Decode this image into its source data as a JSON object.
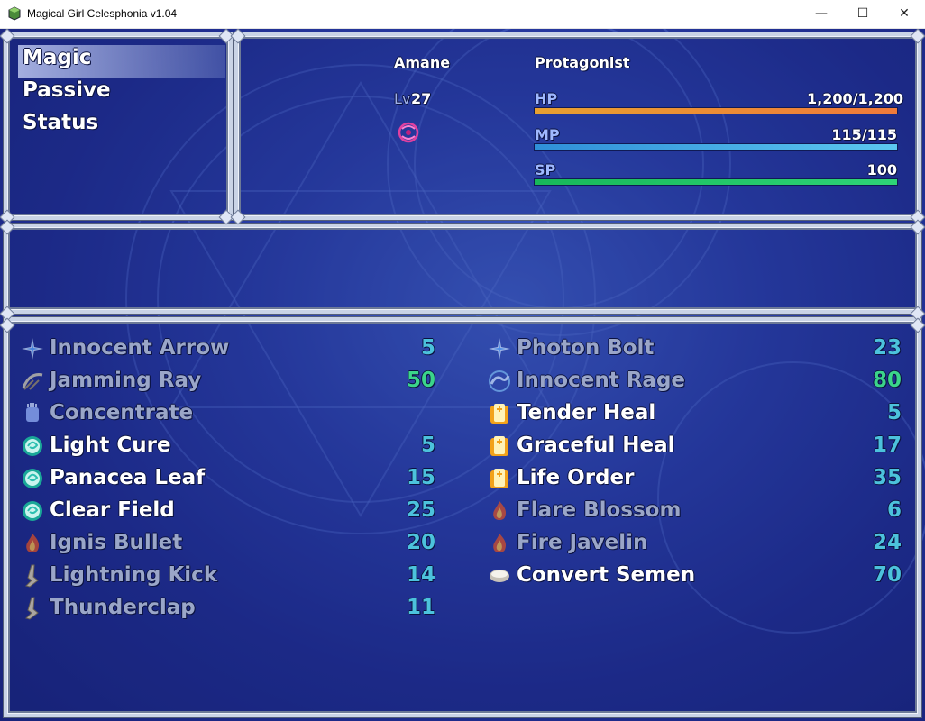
{
  "window": {
    "title": "Magical Girl Celesphonia v1.04",
    "min_glyph": "—",
    "max_glyph": "☐",
    "close_glyph": "✕"
  },
  "commands": [
    {
      "label": "Magic",
      "selected": true
    },
    {
      "label": "Passive",
      "selected": false
    },
    {
      "label": "Status",
      "selected": false
    }
  ],
  "actor": {
    "name": "Amane",
    "class": "Protagonist",
    "level_label": "Lv",
    "level": "27",
    "state_icon": "spiral-state-icon",
    "hp": {
      "label": "HP",
      "value": "1,200/1,200",
      "ratio": 1.0
    },
    "mp": {
      "label": "MP",
      "value": "115/115",
      "ratio": 1.0
    },
    "sp": {
      "label": "SP",
      "value": "100",
      "ratio": 1.0
    }
  },
  "colors": {
    "hp_bar": "#e8a030",
    "hp_bar2": "#f07a3a",
    "mp_bar": "#2f8fd8",
    "mp_bar2": "#5cc8f0",
    "sp_bar": "#18b85a",
    "sp_bar2": "#2ed477"
  },
  "skills_left": [
    {
      "name": "Innocent Arrow",
      "cost": "5",
      "icon": "star-burst-icon",
      "enabled": false,
      "cost_color": "teal"
    },
    {
      "name": "Jamming Ray",
      "cost": "50",
      "icon": "ray-icon",
      "enabled": false,
      "cost_color": "green"
    },
    {
      "name": "Concentrate",
      "cost": "",
      "icon": "hand-icon",
      "enabled": false,
      "cost_color": "teal"
    },
    {
      "name": "Light Cure",
      "cost": "5",
      "icon": "swirl-orb-icon",
      "enabled": true,
      "cost_color": "teal"
    },
    {
      "name": "Panacea Leaf",
      "cost": "15",
      "icon": "swirl-orb-icon",
      "enabled": true,
      "cost_color": "teal"
    },
    {
      "name": "Clear Field",
      "cost": "25",
      "icon": "swirl-orb-icon",
      "enabled": true,
      "cost_color": "teal"
    },
    {
      "name": "Ignis Bullet",
      "cost": "20",
      "icon": "flame-icon",
      "enabled": false,
      "cost_color": "teal"
    },
    {
      "name": "Lightning Kick",
      "cost": "14",
      "icon": "lightning-icon",
      "enabled": false,
      "cost_color": "teal"
    },
    {
      "name": "Thunderclap",
      "cost": "11",
      "icon": "lightning-icon",
      "enabled": false,
      "cost_color": "teal"
    }
  ],
  "skills_right": [
    {
      "name": "Photon Bolt",
      "cost": "23",
      "icon": "star-burst-icon",
      "enabled": false,
      "cost_color": "teal"
    },
    {
      "name": "Innocent Rage",
      "cost": "80",
      "icon": "wave-icon",
      "enabled": false,
      "cost_color": "green"
    },
    {
      "name": "Tender Heal",
      "cost": "5",
      "icon": "heal-pillar-icon",
      "enabled": true,
      "cost_color": "teal"
    },
    {
      "name": "Graceful Heal",
      "cost": "17",
      "icon": "heal-pillar-icon",
      "enabled": true,
      "cost_color": "teal"
    },
    {
      "name": "Life Order",
      "cost": "35",
      "icon": "heal-pillar-icon",
      "enabled": true,
      "cost_color": "teal"
    },
    {
      "name": "Flare Blossom",
      "cost": "6",
      "icon": "flame-icon",
      "enabled": false,
      "cost_color": "teal"
    },
    {
      "name": "Fire Javelin",
      "cost": "24",
      "icon": "flame-icon",
      "enabled": false,
      "cost_color": "teal"
    },
    {
      "name": "Convert Semen",
      "cost": "70",
      "icon": "bowl-icon",
      "enabled": true,
      "cost_color": "teal"
    }
  ]
}
